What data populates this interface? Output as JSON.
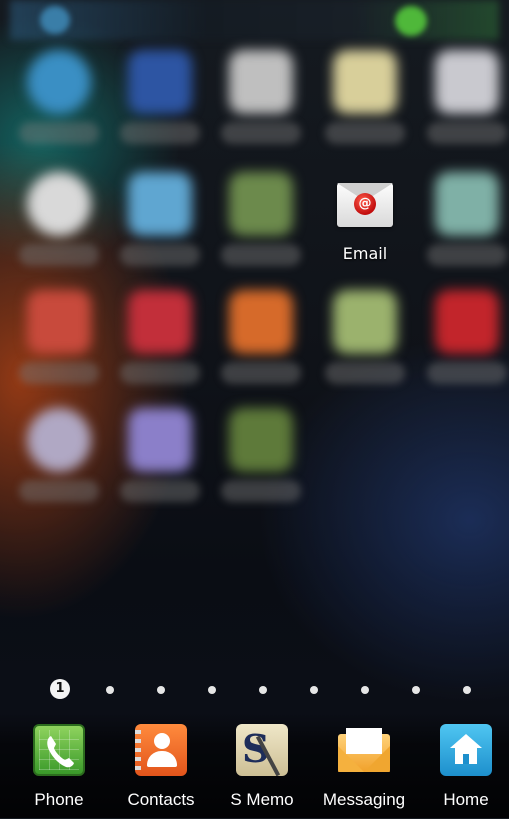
{
  "app_grid": {
    "visible_app": {
      "label": "Email",
      "icon": "email-icon"
    },
    "blurred_rows": 4
  },
  "page_indicator": {
    "current_page": "1",
    "total_pages": 9
  },
  "dock": {
    "items": [
      {
        "label": "Phone",
        "icon": "phone-icon"
      },
      {
        "label": "Contacts",
        "icon": "contacts-icon"
      },
      {
        "label": "S Memo",
        "icon": "s-memo-icon"
      },
      {
        "label": "Messaging",
        "icon": "messaging-icon"
      },
      {
        "label": "Home",
        "icon": "home-icon"
      }
    ]
  },
  "colors": {
    "email_accent": "#c10d0d",
    "dock_text": "#ffffff"
  }
}
